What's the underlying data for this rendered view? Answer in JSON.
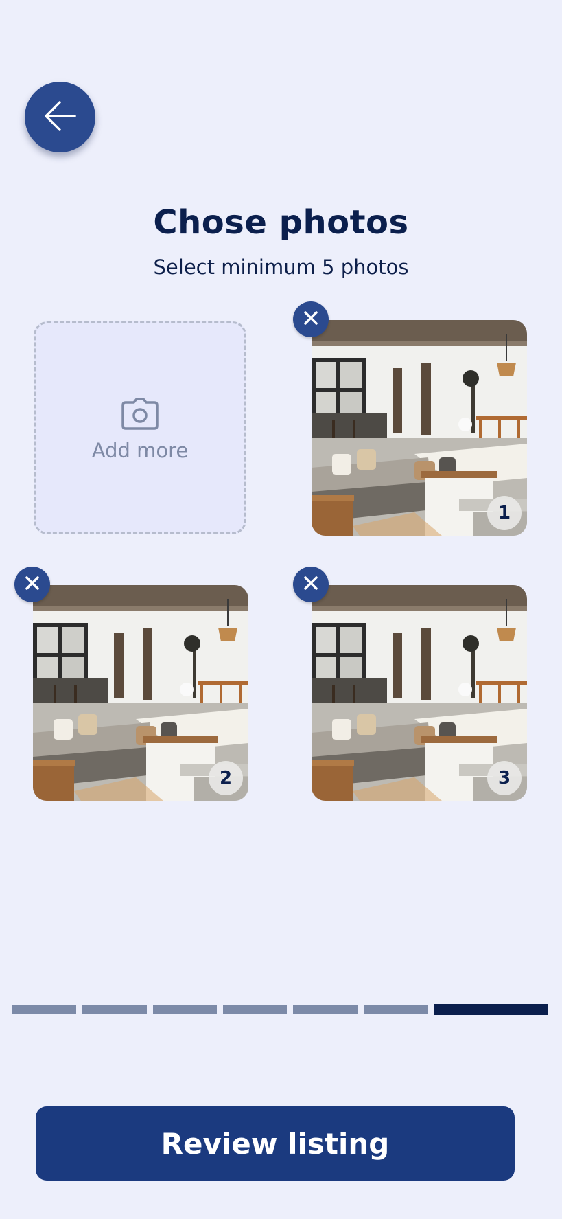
{
  "header": {
    "back_icon": "arrow-left-icon",
    "title": "Chose photos",
    "subtitle": "Select minimum 5 photos"
  },
  "add_more": {
    "icon": "camera-icon",
    "label": "Add more"
  },
  "photos": [
    {
      "order": "1",
      "remove_icon": "close-icon"
    },
    {
      "order": "2",
      "remove_icon": "close-icon"
    },
    {
      "order": "3",
      "remove_icon": "close-icon"
    }
  ],
  "progress": {
    "total_steps": 7,
    "current_step": 7
  },
  "footer": {
    "review_label": "Review listing"
  },
  "colors": {
    "background": "#edeffb",
    "accent": "#1b3a7f",
    "title": "#0b1f4d",
    "progress_inactive": "#7c8aa8",
    "progress_active": "#0b1f4d"
  }
}
